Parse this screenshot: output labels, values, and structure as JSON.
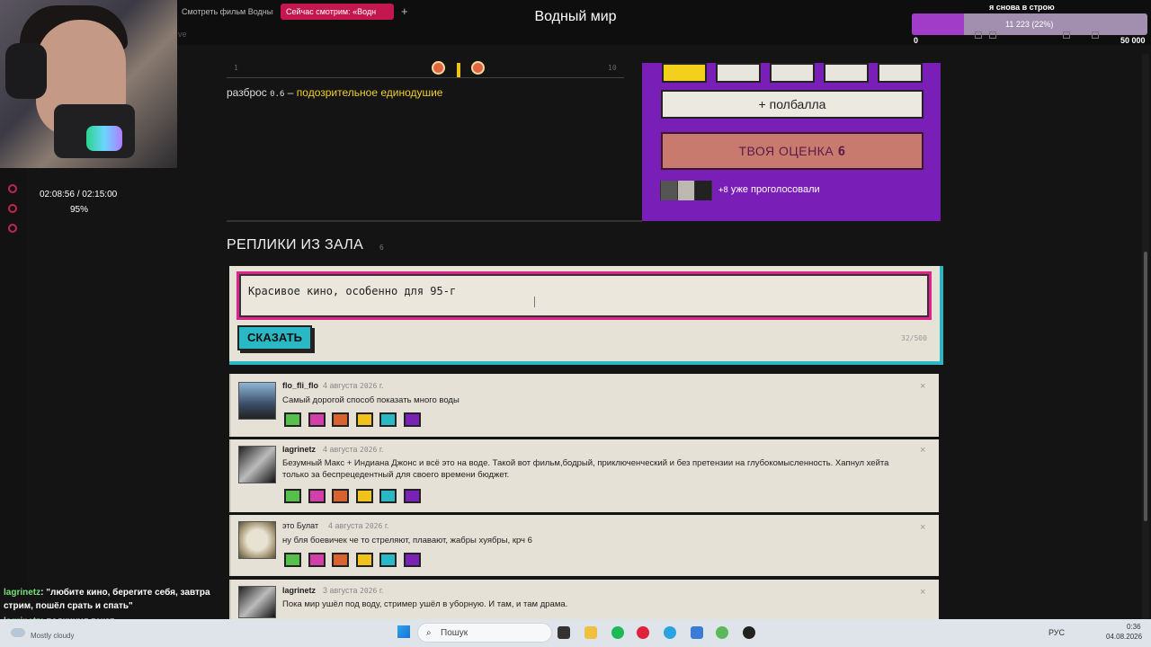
{
  "browser": {
    "tabs": [
      "Смотреть фильм Водный",
      "Сейчас смотрим: «Водн"
    ],
    "new_tab": "+",
    "movie_title": "Водный мир",
    "sub_hint": "ve"
  },
  "stream_overlay": {
    "goal_title": "я снова в строю",
    "goal_progress": "11 223  (22%)",
    "goal_fraction": 0.22,
    "goal_min": "0",
    "goal_max": "50 000",
    "playback_time": "02:08:56 / 02:15:00",
    "playback_percent": "95%"
  },
  "rating": {
    "slider_min": "1",
    "slider_max": "10",
    "spread_prefix": "разброс",
    "spread_value": "0.6",
    "spread_dash": "–",
    "spread_verdict": "подозрительное единодушие",
    "half_point_label": "+ полбалла",
    "your_score_label": "ТВОЯ ОЦЕНКА",
    "your_score_value": "6",
    "voters_extra": "+8",
    "voters_text": "уже проголосовали",
    "accent_color": "#7a1eb8"
  },
  "comments_section": {
    "title": "РЕПЛИКИ ИЗ ЗАЛА",
    "count": "6",
    "input_value": "Красивое кино, особенно для 95-г",
    "submit_label": "СКАЗАТЬ",
    "char_counter": "32/500"
  },
  "comments": [
    {
      "author": "flo_fli_flo",
      "date_prefix": "4 августа",
      "date_year": "2026",
      "date_suffix": "г.",
      "text": "Самый дорогой способ показать много воды"
    },
    {
      "author": "lagrinetz",
      "date_prefix": "4 августа",
      "date_year": "2026",
      "date_suffix": "г.",
      "text": "Безумный Макс + Индиана Джонс и всё это на воде. Такой вот фильм,бодрый, приключенческий и без претензии на глубокомысленность. Хапнул хейта только за беспрецедентный для своего времени бюджет."
    },
    {
      "author": "это Булат",
      "date_prefix": "4 августа",
      "date_year": "2026",
      "date_suffix": "г.",
      "text": "ну бля боевичек че то стреляют, плавают, жабры хуябры, крч 6"
    },
    {
      "author": "lagrinetz",
      "date_prefix": "3 августа",
      "date_year": "2026",
      "date_suffix": "г.",
      "text": "Пока мир ушёл под воду, стример ушёл в уборную. И там, и там драма."
    }
  ],
  "close_glyph": "×",
  "chat": {
    "user1": "lagrinetz",
    "msg1": ": \"любите кино, берегите себя, завтра стрим, пошёл срать и спать\"",
    "user2": "lagrinetz",
    "msg2": ": подкинул текст"
  },
  "taskbar": {
    "weather": "Mostly cloudy",
    "search_placeholder": "Пошук",
    "language": "РУС",
    "time": "0:36",
    "date": "04.08.2026"
  }
}
